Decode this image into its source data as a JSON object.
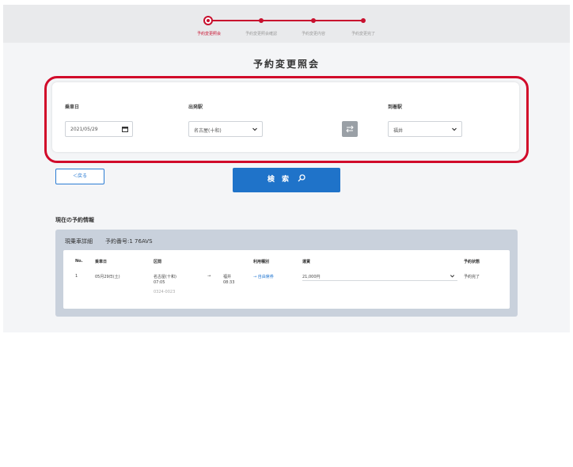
{
  "stepper": {
    "steps": [
      {
        "label": "予約変更照会"
      },
      {
        "label": "予約変更照会確認"
      },
      {
        "label": "予約変更内容"
      },
      {
        "label": "予約変更完了"
      }
    ]
  },
  "page": {
    "title": "予約変更照会"
  },
  "search": {
    "date_label": "乗車日",
    "date_value": "2021/05/29",
    "from_label": "出発駅",
    "from_value": "名古屋(十和)",
    "to_label": "到着駅",
    "to_value": "福井",
    "swap_icon": "swap-icon",
    "back_label": "＜戻る",
    "search_label": "検 索"
  },
  "current": {
    "heading": "現在の予約情報",
    "card_title": "現乗車詳細",
    "card_number": "予約番号:1 76AVS",
    "headers": {
      "no": "No.",
      "date": "乗車日",
      "section": "区間",
      "arrive_group": "利用種別",
      "fare": "運賃",
      "status": "予約状態"
    },
    "row": {
      "no": "1",
      "date": "05月29日(土)",
      "from_station": "名古屋(十和)",
      "from_time": "07:05",
      "from_note": "0324-0023",
      "arrow": "→",
      "to_station": "福井",
      "to_time": "08:33",
      "seat_type": "→ 自由席券",
      "fare": "21,000円",
      "status": "予約完了"
    }
  }
}
